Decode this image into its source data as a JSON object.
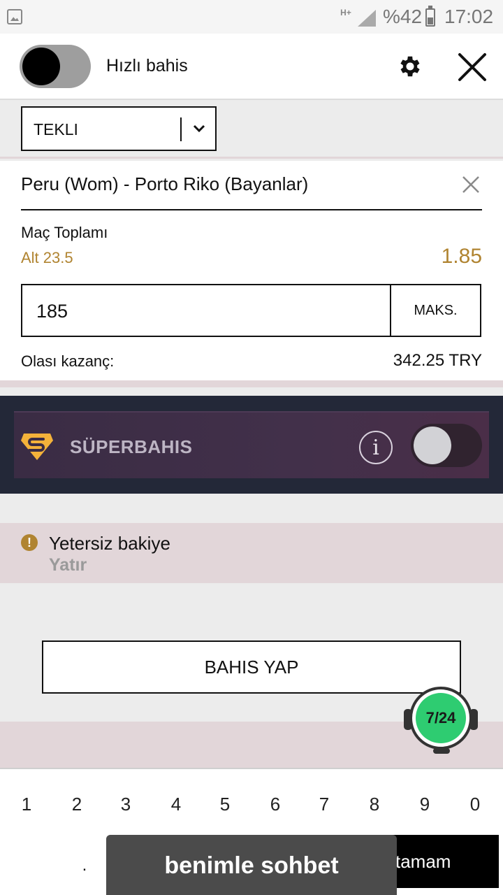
{
  "status_bar": {
    "network": "H+",
    "battery": "%42",
    "time": "17:02"
  },
  "header": {
    "quick_bet_label": "Hızlı bahis"
  },
  "bet_type": {
    "selected": "TEKLI"
  },
  "bet": {
    "match": "Peru (Wom) - Porto Riko (Bayanlar)",
    "market": "Maç Toplamı",
    "selection": "Alt 23.5",
    "odds": "1.85",
    "stake": "185",
    "max_label": "MAKS.",
    "potential_win_label": "Olası kazanç:",
    "potential_win_value": "342.25 TRY"
  },
  "superbahis": {
    "label": "SÜPERBAHIS",
    "info_symbol": "i"
  },
  "balance": {
    "message": "Yetersiz bakiye",
    "deposit_label": "Yatır",
    "warn_symbol": "!"
  },
  "place_bet_label": "BAHIS YAP",
  "support": {
    "label": "7/24"
  },
  "keyboard": {
    "keys": [
      "1",
      "2",
      "3",
      "4",
      "5",
      "6",
      "7",
      "8",
      "9",
      "0"
    ],
    "dot": ".",
    "done_label": "tamam"
  },
  "chat_label": "benimle sohbet",
  "colors": {
    "accent_gold": "#b08431",
    "super_bg": "#232838",
    "balance_bg": "#e2d6d9",
    "support_green": "#2ecc71"
  }
}
